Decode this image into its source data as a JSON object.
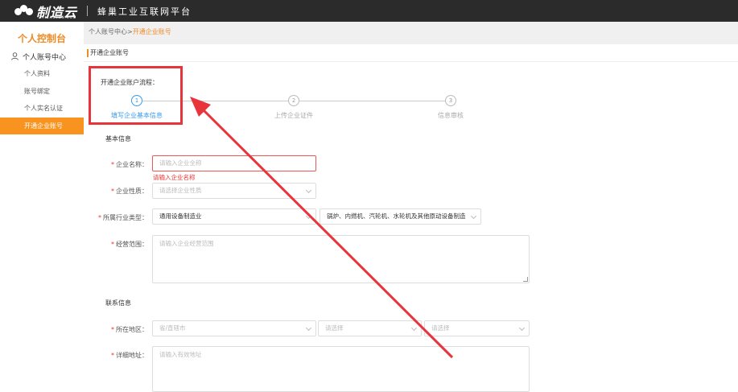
{
  "header": {
    "logo_text": "制造云",
    "logo_subtext": "ZHIZAOYUN.COM",
    "platform_title": "蜂巢工业互联网平台"
  },
  "sidebar": {
    "title": "个人控制台",
    "group_label": "个人账号中心",
    "items": [
      {
        "label": "个人资料"
      },
      {
        "label": "账号绑定"
      },
      {
        "label": "个人实名认证"
      },
      {
        "label": "开通企业账号"
      }
    ]
  },
  "breadcrumb": {
    "parent": "个人账号中心",
    "separator": ">",
    "current": "开通企业账号"
  },
  "section": {
    "title": "开通企业账号",
    "flow_label": "开通企业账户流程："
  },
  "steps": [
    {
      "num": "1",
      "label": "填写企业基本信息"
    },
    {
      "num": "2",
      "label": "上传企业证件"
    },
    {
      "num": "3",
      "label": "信息审核"
    }
  ],
  "basic_info": {
    "title": "基本信息",
    "company_name_label": "企业名称：",
    "company_name_placeholder": "请输入企业全称",
    "company_name_error": "请输入企业名称",
    "nature_label": "企业性质：",
    "nature_placeholder": "请选择企业性质",
    "industry_label": "所属行业类型：",
    "industry_value": "通用设备制造业",
    "industry_sub_value": "锅炉、内燃机、汽轮机、水轮机及其他原动设备制造",
    "scope_label": "经营范围：",
    "scope_placeholder": "请输入企业经营范围"
  },
  "contact_info": {
    "title": "联系信息",
    "region_label": "所在地区：",
    "province_placeholder": "省/直辖市",
    "city_placeholder": "请选择",
    "district_placeholder": "请选择",
    "address_label": "详细地址：",
    "address_placeholder": "请输入有效地址"
  },
  "colors": {
    "brand_orange": "#f7931e",
    "active_blue": "#3a9bef",
    "error_red": "#e33333",
    "annotation_red": "#e8353b"
  }
}
